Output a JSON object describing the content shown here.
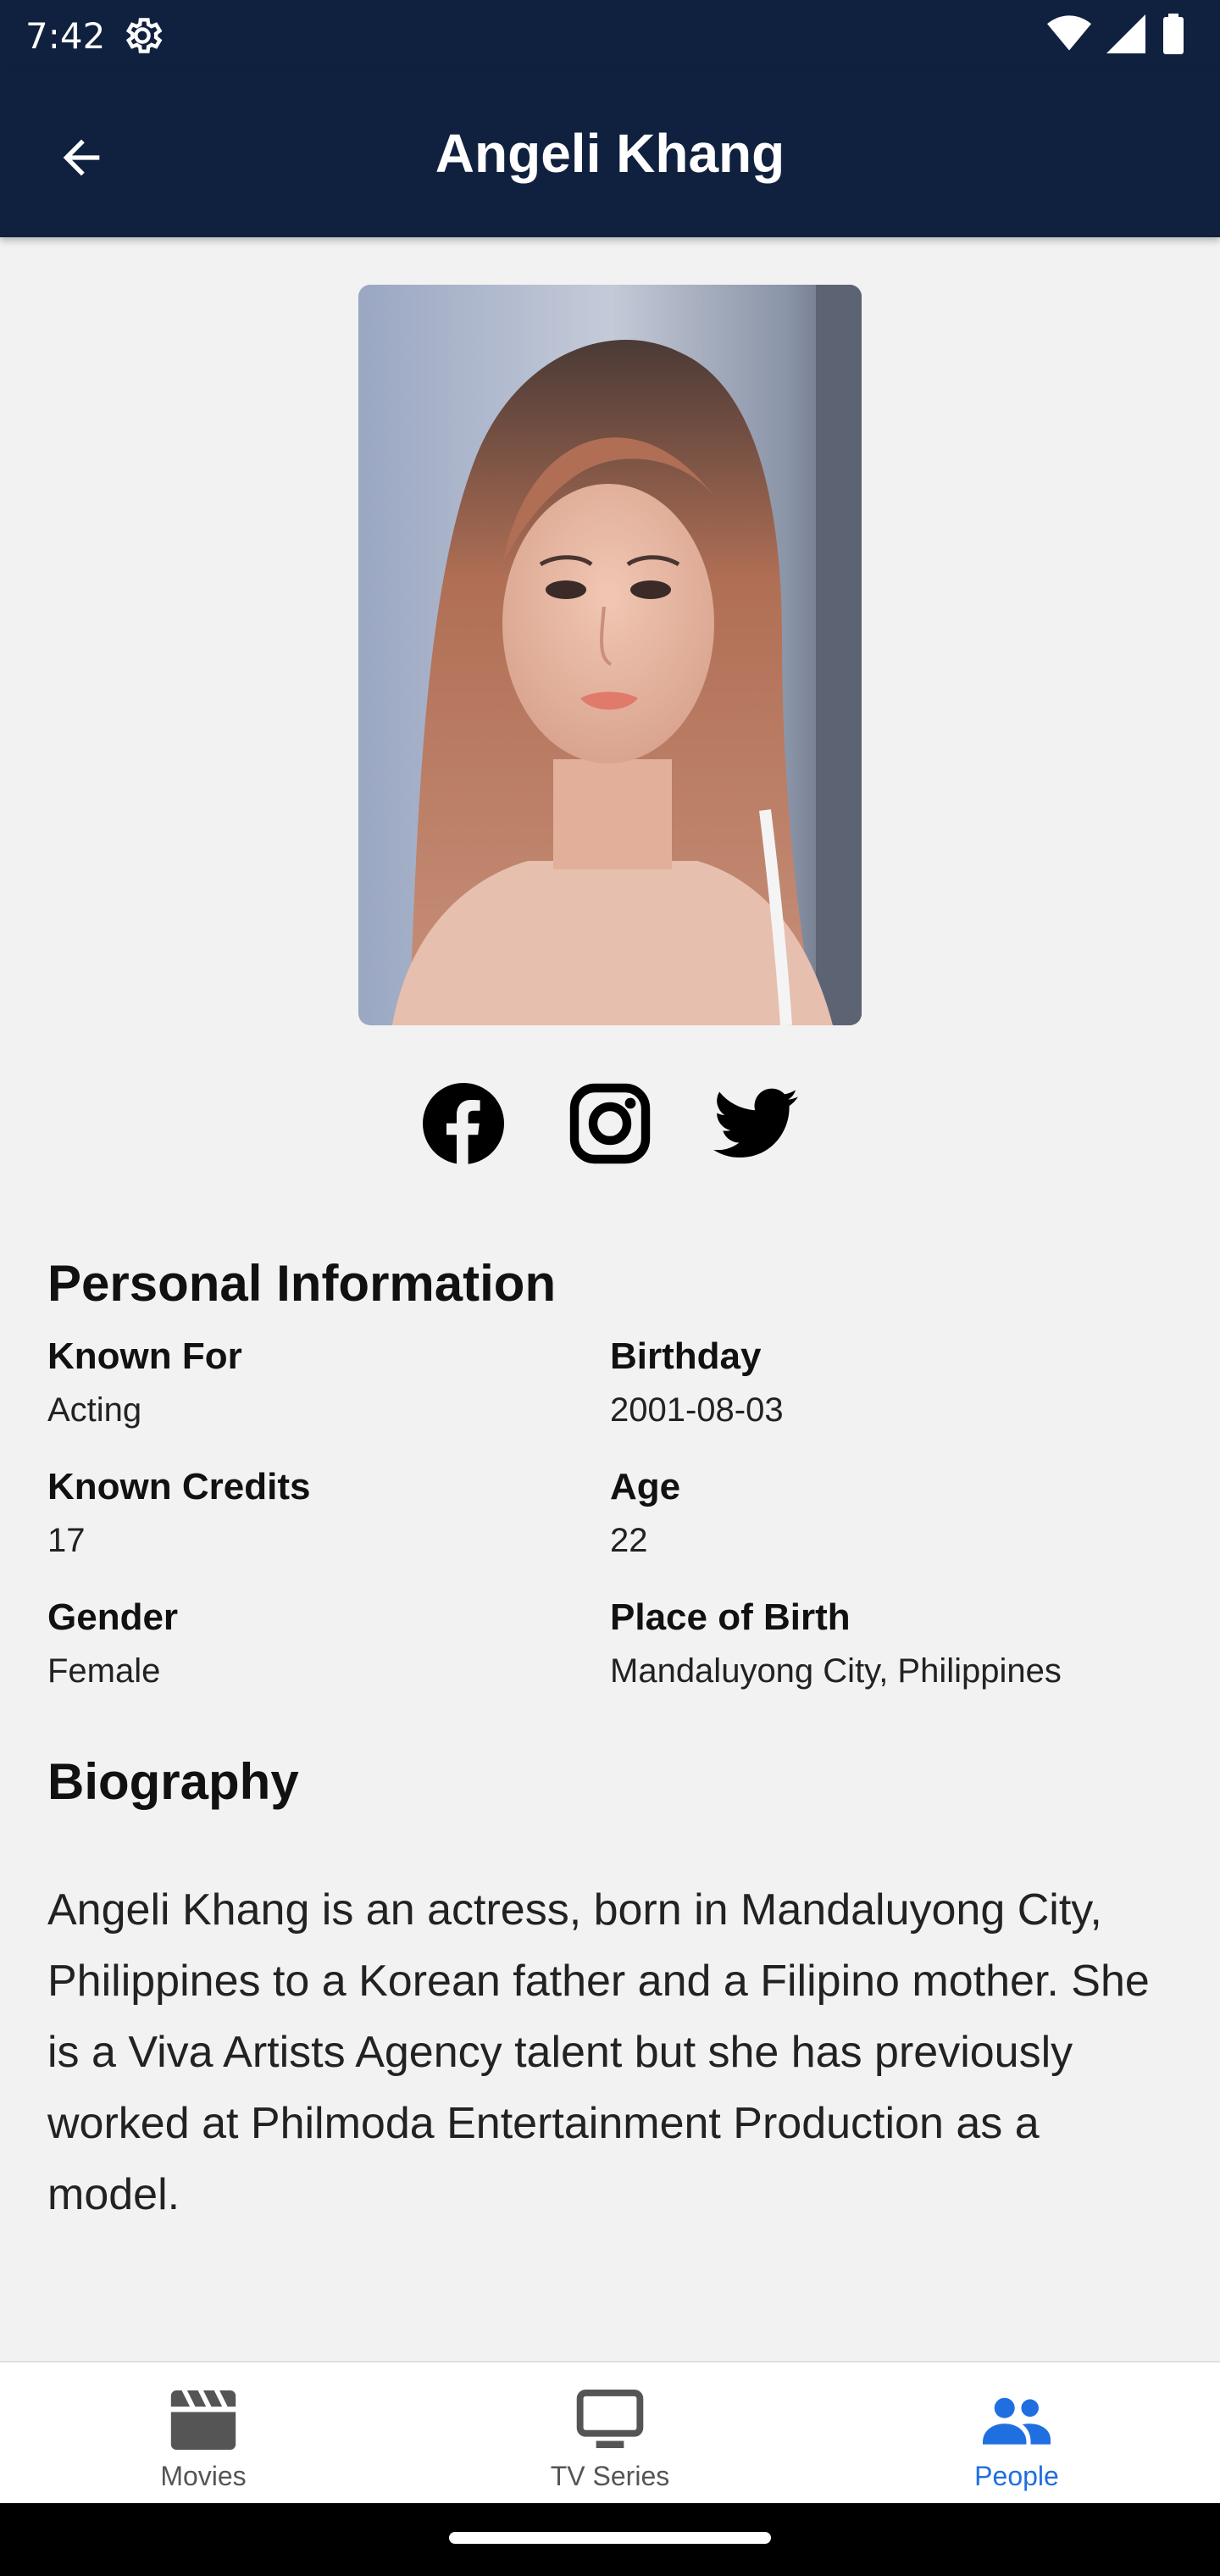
{
  "status_bar": {
    "time": "7:42"
  },
  "app_bar": {
    "title": "Angeli Khang",
    "back_icon": "arrow-back-icon"
  },
  "profile": {
    "photo_alt": "Angeli Khang portrait"
  },
  "social_links": [
    {
      "name": "facebook",
      "icon": "facebook-icon"
    },
    {
      "name": "instagram",
      "icon": "instagram-icon"
    },
    {
      "name": "twitter",
      "icon": "twitter-icon"
    }
  ],
  "personal_info": {
    "title": "Personal Information",
    "known_for": {
      "label": "Known For",
      "value": "Acting"
    },
    "birthday": {
      "label": "Birthday",
      "value": "2001-08-03"
    },
    "known_credits": {
      "label": "Known Credits",
      "value": "17"
    },
    "age": {
      "label": "Age",
      "value": "22"
    },
    "gender": {
      "label": "Gender",
      "value": "Female"
    },
    "place_of_birth": {
      "label": "Place of Birth",
      "value": "Mandaluyong City, Philippines"
    }
  },
  "biography": {
    "title": "Biography",
    "text": "Angeli Khang is an actress, born in Mandaluyong City, Philippines to a Korean father and a Filipino mother. She is a Viva Artists Agency talent but she has previously worked at Philmoda Entertainment Production as a model."
  },
  "bottom_nav": {
    "items": [
      {
        "label": "Movies",
        "icon": "clapperboard-icon",
        "active": false
      },
      {
        "label": "TV Series",
        "icon": "tv-icon",
        "active": false
      },
      {
        "label": "People",
        "icon": "people-icon",
        "active": true
      }
    ]
  },
  "colors": {
    "app_bar": "#10213f",
    "accent": "#1f6fe0",
    "background": "#f2f2f2"
  }
}
